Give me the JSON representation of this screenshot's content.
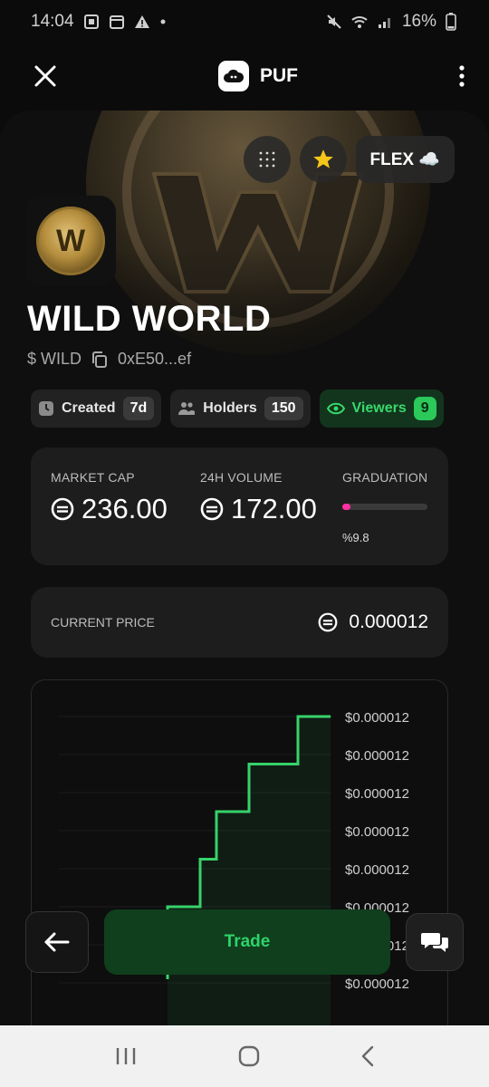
{
  "statusbar": {
    "time": "14:04",
    "battery": "16%"
  },
  "appbar": {
    "title": "PUF"
  },
  "hero": {
    "flex_label": "FLEX ☁️"
  },
  "token": {
    "name": "WILD WORLD",
    "ticker": "$ WILD",
    "address": "0xE50...ef",
    "avatar_letter": "W"
  },
  "chips": {
    "created_label": "Created",
    "created_value": "7d",
    "holders_label": "Holders",
    "holders_value": "150",
    "viewers_label": "Viewers",
    "viewers_value": "9"
  },
  "stats": {
    "market_cap_label": "MARKET CAP",
    "market_cap_value": "236.00",
    "volume_label": "24H VOLUME",
    "volume_value": "172.00",
    "graduation_label": "GRADUATION",
    "graduation_fraction": 0.098,
    "graduation_text": "%9.8"
  },
  "price": {
    "label": "CURRENT PRICE",
    "value": "0.000012"
  },
  "chart_data": {
    "type": "line",
    "series": [
      {
        "values": [
          1.18e-05,
          1.18e-05,
          1.19e-05,
          1.2e-05,
          1.2e-05,
          1.21e-05,
          1.21e-05,
          1.21e-05,
          1.22e-05,
          1.22e-05,
          1.22e-05
        ]
      }
    ],
    "y_tick_labels": [
      "$0.000012",
      "$0.000012",
      "$0.000012",
      "$0.000012",
      "$0.000012",
      "$0.000012",
      "$0.000012",
      "$0.000012"
    ],
    "colors": {
      "line": "#36d26a"
    }
  },
  "actions": {
    "trade_label": "Trade"
  },
  "colors": {
    "accent_green": "#2fd26b",
    "graduation_pink": "#ff2fa0"
  }
}
